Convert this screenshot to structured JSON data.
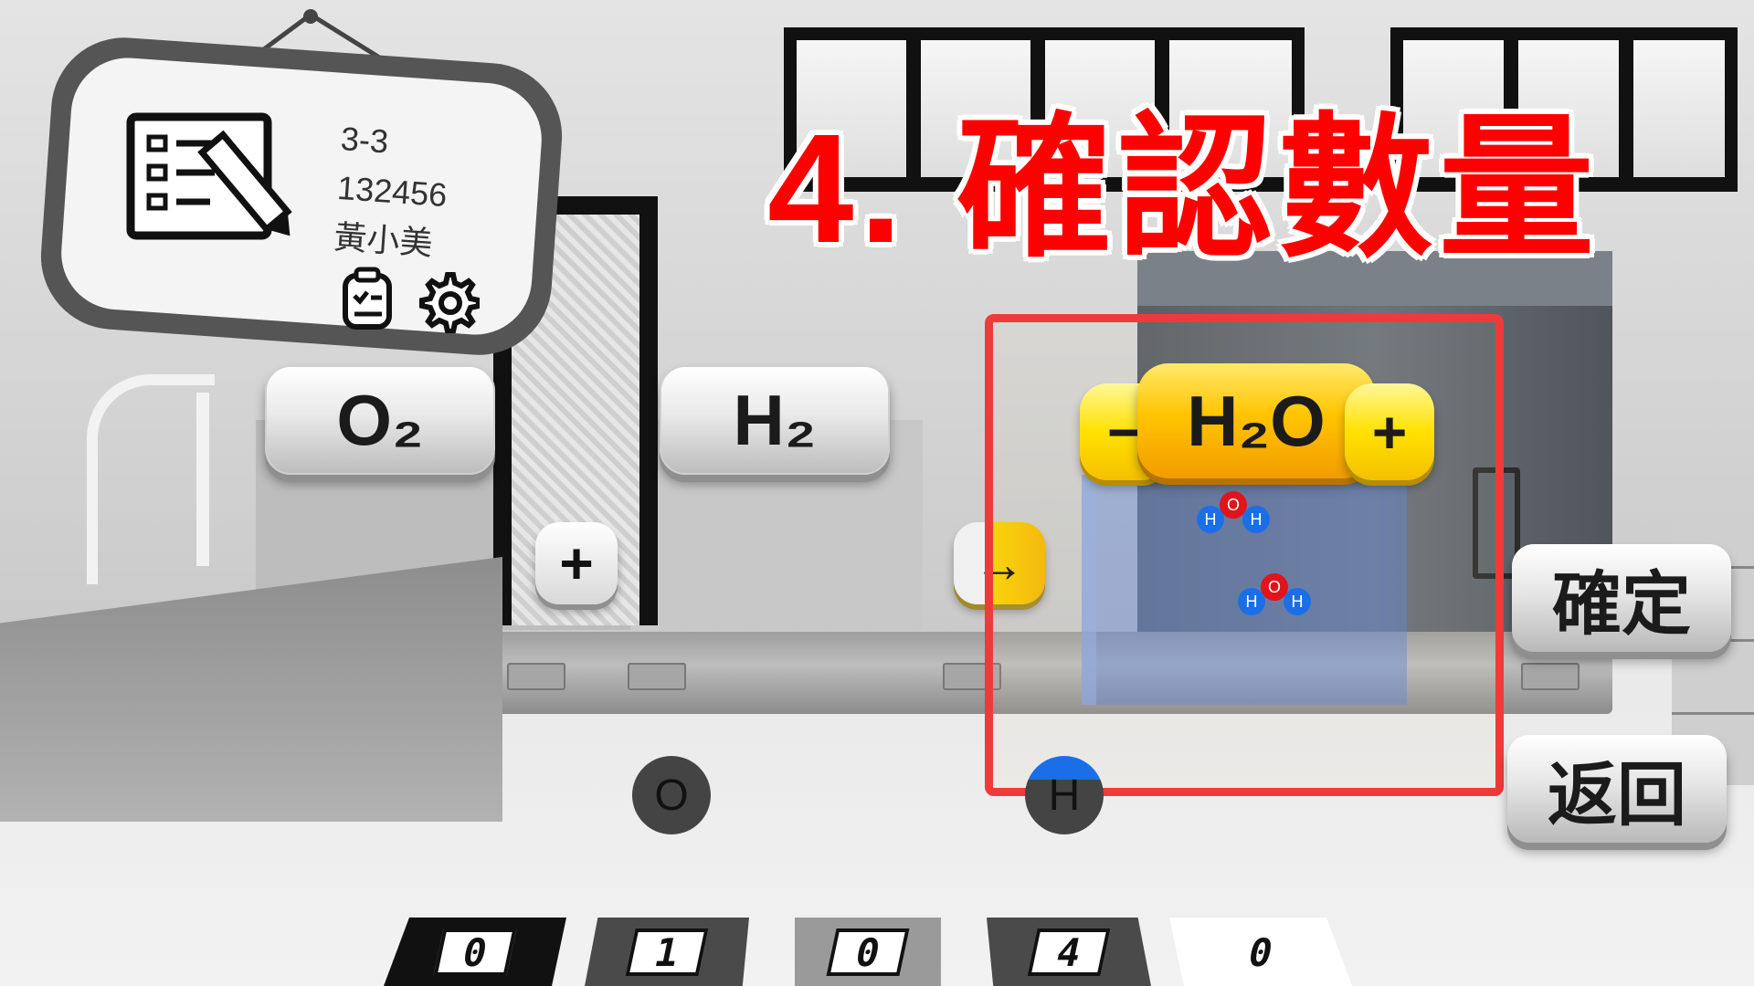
{
  "title": "4. 確認數量",
  "user": {
    "class": "3-3",
    "id": "132456",
    "name": "黃小美"
  },
  "icons": {
    "profile": "list-pencil-icon",
    "clipboard": "clipboard-check-icon",
    "settings": "gear-icon"
  },
  "reactants": [
    {
      "label": "O₂"
    },
    {
      "label": "H₂"
    }
  ],
  "operators": {
    "plus": "+",
    "arrow": "→"
  },
  "product": {
    "label": "H₂O",
    "minus": "−",
    "plus": "+",
    "molecules": [
      {
        "o": "O",
        "h1": "H",
        "h2": "H"
      },
      {
        "o": "O",
        "h1": "H",
        "h2": "H"
      }
    ]
  },
  "buttons": {
    "confirm": "確定",
    "back": "返回"
  },
  "atom_selectors": [
    {
      "label": "O",
      "color": "#444444"
    },
    {
      "label": "H",
      "color": "#1a6fe8"
    }
  ],
  "counters": [
    "0",
    "1",
    "0",
    "4",
    "0"
  ],
  "colors": {
    "title": "#ff0000",
    "highlight": "#f03a3a",
    "product_button": "#ffc400",
    "oxygen": "#e0141a",
    "hydrogen": "#1a6fe8"
  }
}
